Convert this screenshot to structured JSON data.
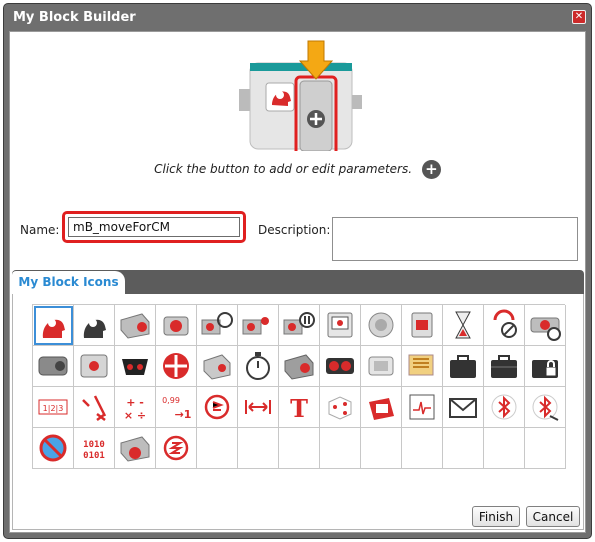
{
  "window": {
    "title": "My Block Builder",
    "close_icon": "close-icon"
  },
  "preview": {
    "block_icon": "head-gears-icon",
    "add_param_icon": "plus-circle-icon",
    "arrow_icon": "arrow-down-icon"
  },
  "hint": {
    "text": "Click the button to add or edit parameters.",
    "icon": "plus-circle-icon"
  },
  "name": {
    "label": "Name:",
    "value": "mB_moveForCM"
  },
  "description": {
    "label": "Description:",
    "value": ""
  },
  "tabs": [
    {
      "label": "My Block Icons",
      "active": true
    }
  ],
  "icons": [
    "head-gears-icon",
    "head-gears-icon-gray",
    "large-motor-icon",
    "medium-motor-icon",
    "move-steering-icon",
    "move-tank-icon",
    "motor-sliders-icon",
    "display-icon",
    "sound-icon",
    "brick-light-icon",
    "hourglass-icon",
    "loop-interrupt-icon",
    "motor-stop-icon",
    "color-sensor-icon",
    "gyro-sensor-icon",
    "ir-sensor-icon",
    "ir-remote-icon",
    "rotation-sensor-icon",
    "timer-icon",
    "motor-rotation-icon",
    "ultrasonic-sensor-icon",
    "brick-button-icon",
    "energy-meter-icon",
    "file-access-icon",
    "brick-icon",
    "brick-lock-icon",
    "array-icon",
    "logic-icon",
    "math-icon",
    "round-icon",
    "compare-icon",
    "range-icon",
    "text-icon",
    "random-icon",
    "variable-icon",
    "datalog-icon",
    "messaging-icon",
    "bluetooth-icon",
    "bluetooth-wake-icon",
    "no-bluetooth-icon",
    "binary-icon",
    "motor-raw-icon",
    "unregulated-icon"
  ],
  "buttons": {
    "finish": "Finish",
    "cancel": "Cancel"
  },
  "colors": {
    "accent": "#2a8ad2",
    "highlight": "#e02020",
    "arrow": "#f4a814",
    "teal": "#1a9a9a",
    "red": "#d92b2b"
  }
}
